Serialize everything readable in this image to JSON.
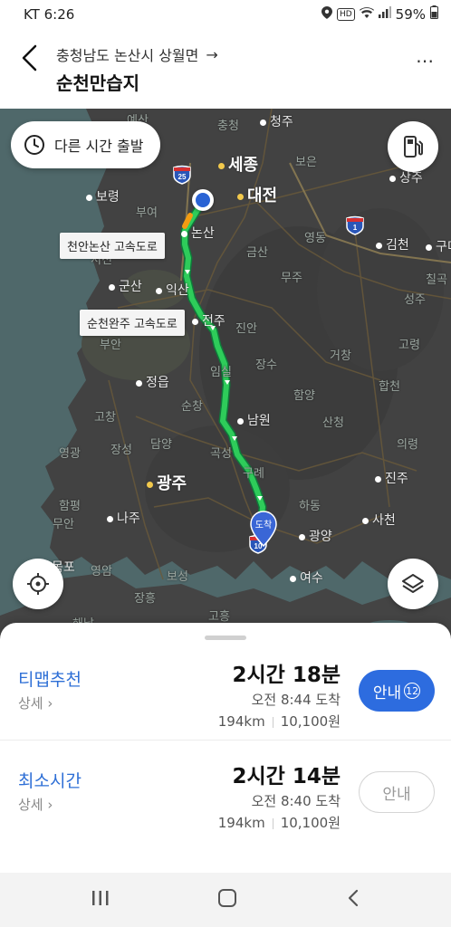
{
  "status": {
    "carrier_time": "KT 6:26",
    "hd": "HD",
    "battery": "59%"
  },
  "header": {
    "origin": "충청남도 논산시 상월면",
    "arrow": "→",
    "destination": "순천만습지",
    "more": "⋯"
  },
  "map": {
    "time_button_label": "다른 시간 출발",
    "road_labels": [
      "천안논산 고속도로",
      "순천완주 고속도로"
    ],
    "arrive_pin": "도착",
    "shields": [
      "25",
      "1",
      "10"
    ],
    "places": {
      "cheongju": "청주",
      "sejong": "세종",
      "daejeon": "대전",
      "boeun": "보은",
      "sangju": "상주",
      "boryeong": "보령",
      "buyeo": "부여",
      "nonsan": "논산",
      "geumsan": "금산",
      "yeongdong": "영동",
      "gimcheon": "김천",
      "gumi": "구미",
      "seocheon": "서천",
      "gunsan": "군산",
      "iksan": "익산",
      "muju": "무주",
      "chilgok": "칠곡",
      "seongju": "성주",
      "jeonju": "전주",
      "jinan": "진안",
      "buan": "부안",
      "goryeong": "고령",
      "geochang": "거창",
      "jangsu": "장수",
      "imsil": "임실",
      "jeongeup": "정읍",
      "hamyang": "함양",
      "hapcheon": "합천",
      "gochang": "고창",
      "sanchung": "산청",
      "namwon": "남원",
      "sunchang": "순창",
      "yeonggwang": "영광",
      "jangseong": "장성",
      "damyang": "담양",
      "gokseong": "곡성",
      "uiryeong": "의령",
      "gwangju": "광주",
      "gurye": "구례",
      "jinju": "진주",
      "hampyeong": "함평",
      "hadong": "하동",
      "muan": "무안",
      "naju": "나주",
      "sacheon": "사천",
      "gwangyang": "광양",
      "mokpo": "목포",
      "yeongam": "영암",
      "boseong": "보성",
      "yeosu": "여수",
      "jangheung": "장흥",
      "goheung": "고흥",
      "haenam": "해남",
      "cheongbuk": "충청",
      "yesan": "예산"
    }
  },
  "routes": [
    {
      "name": "티맵추천",
      "detail": "상세",
      "duration": "2시간 18분",
      "arrival": "오전 8:44 도착",
      "distance": "194km",
      "toll": "10,100원",
      "button": "안내",
      "button_badge": "12"
    },
    {
      "name": "최소시간",
      "detail": "상세",
      "duration": "2시간 14분",
      "arrival": "오전 8:40 도착",
      "distance": "194km",
      "toll": "10,100원",
      "button": "안내"
    }
  ]
}
